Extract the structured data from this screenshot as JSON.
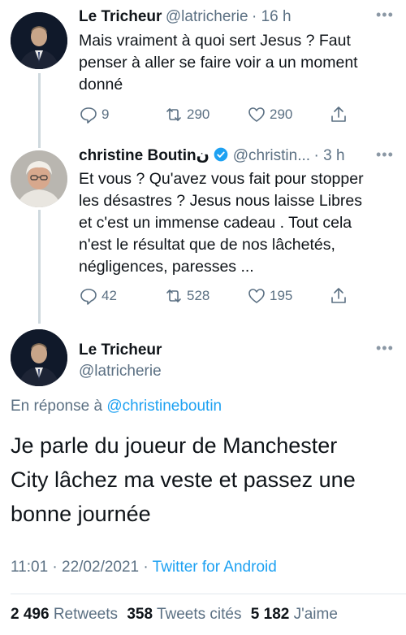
{
  "tweet1": {
    "name": "Le Tricheur",
    "handle": "@latricherie",
    "time": "· 16 h",
    "text_lines": [
      "Mais vraiment à quoi sert Jesus ? Faut",
      "penser à aller se faire voir a un moment",
      "donné"
    ],
    "replies": "9",
    "retweets": "290",
    "likes": "290"
  },
  "tweet2": {
    "name": "christine Boutinن",
    "handle": "@christin...",
    "time": "· 3 h",
    "text_lines": [
      "Et vous ? Qu'avez vous fait pour stopper",
      "les désastres ? Jesus nous laisse Libres",
      "et c'est un immense cadeau . Tout cela",
      "n'est le résultat que de nos lâchetés,",
      "négligences, paresses ..."
    ],
    "replies": "42",
    "retweets": "528",
    "likes": "195"
  },
  "main_tweet": {
    "name": "Le Tricheur",
    "handle": "@latricherie",
    "reply_prefix": "En réponse à",
    "reply_to": "@christineboutin",
    "text_lines": [
      "Je parle du joueur de Manchester",
      "City lâchez ma veste et passez une",
      "bonne journée"
    ],
    "timestamp": "11:01 · 22/02/2021 ·",
    "source": "Twitter for Android",
    "retweets_count": "2 496",
    "retweets_label": "Retweets",
    "quotes_count": "358",
    "quotes_label": "Tweets cités",
    "likes_count": "5 182",
    "likes_label": "J'aime"
  },
  "colors": {
    "link": "#1da1f2",
    "secondary": "#5b7083",
    "verified": "#1da1f2"
  },
  "icons": [
    "more-icon",
    "reply-icon",
    "retweet-icon",
    "like-icon",
    "share-icon",
    "verified-badge-icon"
  ]
}
